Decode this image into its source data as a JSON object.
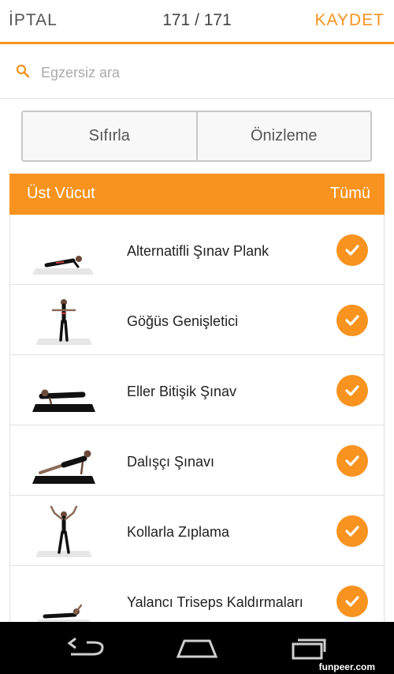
{
  "header": {
    "cancel_label": "İPTAL",
    "counter": "171 / 171",
    "save_label": "KAYDET"
  },
  "search": {
    "placeholder": "Egzersiz ara",
    "value": "",
    "icon": "search-icon"
  },
  "actions": {
    "reset_label": "Sıfırla",
    "preview_label": "Önizleme"
  },
  "section": {
    "title": "Üst Vücut",
    "select_all_label": "Tümü"
  },
  "exercises": [
    {
      "name": "Alternatifli Şınav Plank",
      "selected": true,
      "pose": "plank"
    },
    {
      "name": "Göğüs Genişletici",
      "selected": true,
      "pose": "standing-arms-out"
    },
    {
      "name": "Eller Bitişik Şınav",
      "selected": true,
      "pose": "pushup"
    },
    {
      "name": "Dalışçı Şınavı",
      "selected": true,
      "pose": "dive-pushup"
    },
    {
      "name": "Kollarla Zıplama",
      "selected": true,
      "pose": "jumping-arms-up"
    },
    {
      "name": "Yalancı Triseps Kaldırmaları",
      "selected": true,
      "pose": "lying"
    }
  ],
  "system_nav": {
    "back_icon": "back-icon",
    "home_icon": "home-icon",
    "recents_icon": "recents-icon",
    "watermark": "funpeer.com"
  },
  "colors": {
    "accent": "#f7931e",
    "text": "#222222",
    "navbar": "#000000"
  }
}
